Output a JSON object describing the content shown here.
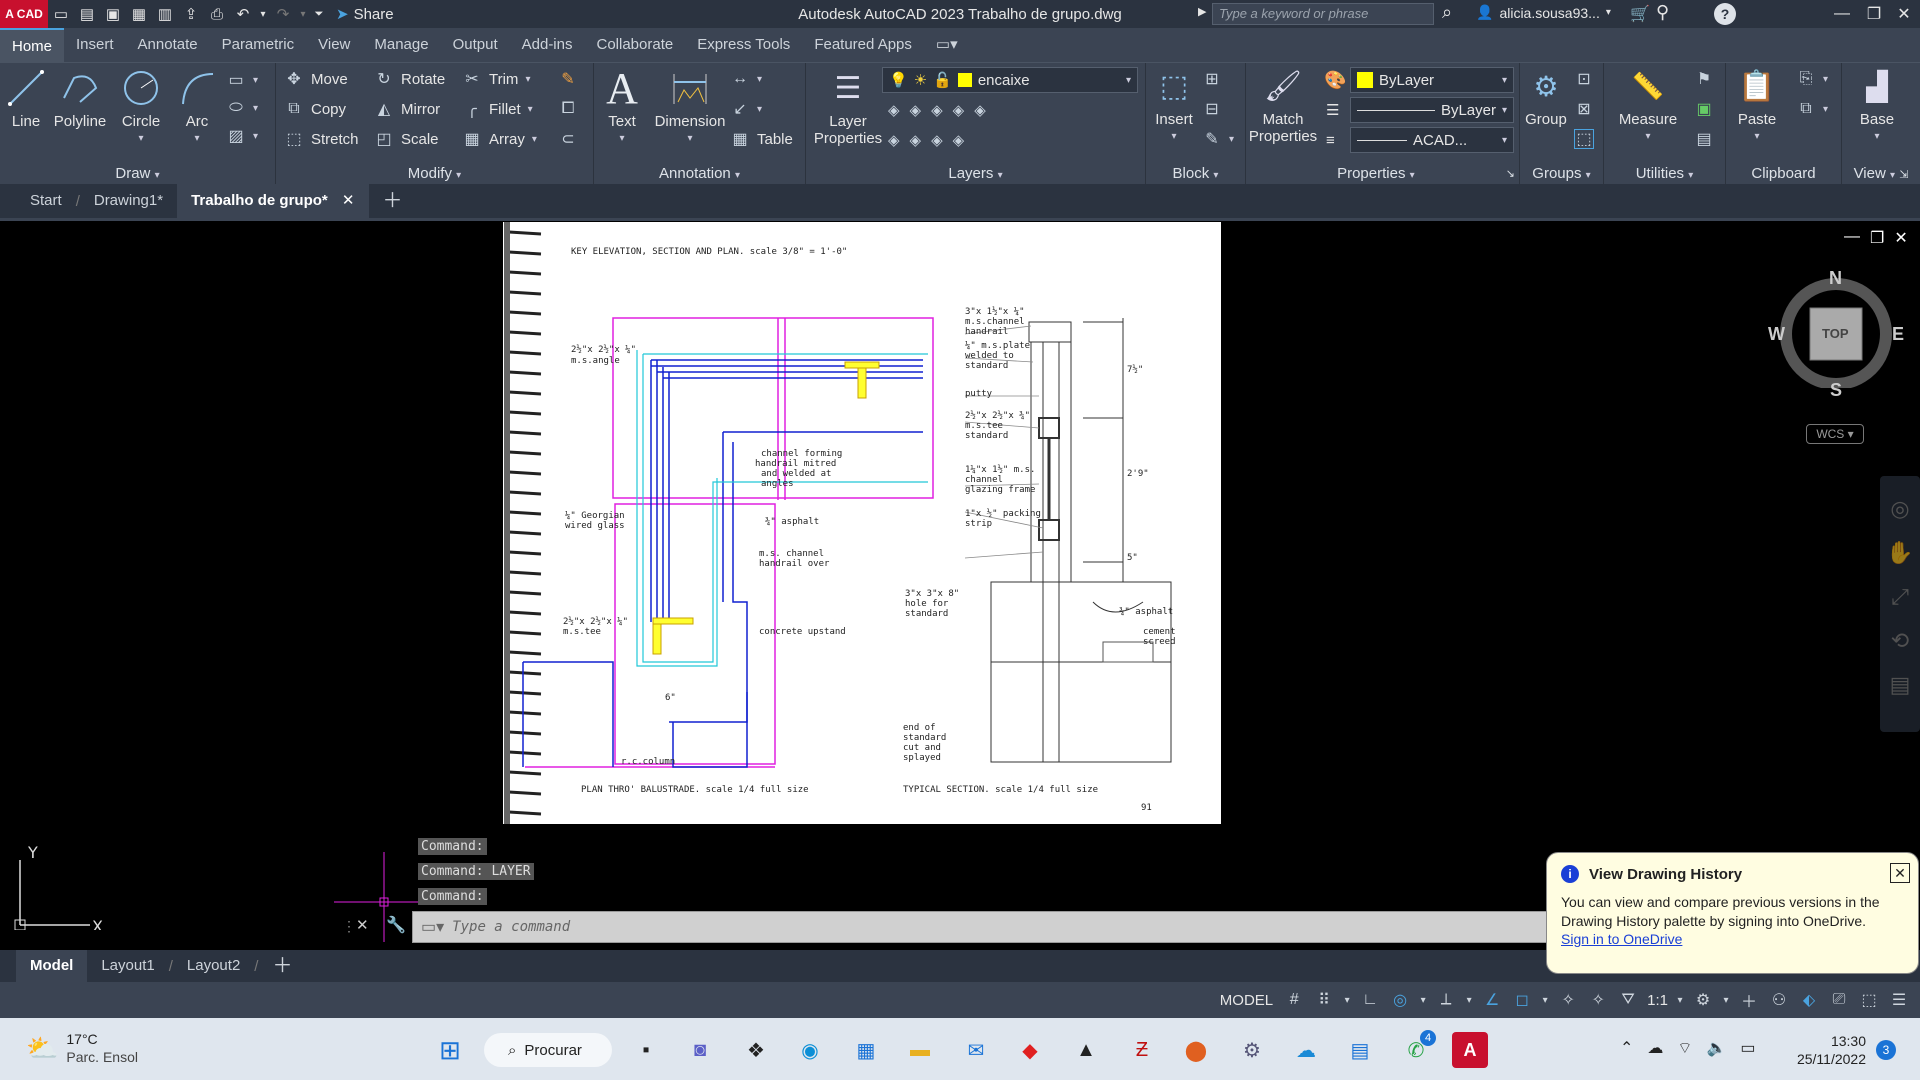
{
  "titlebar": {
    "logo": "A CAD",
    "share": "Share",
    "app_title": "Autodesk AutoCAD 2023    Trabalho de grupo.dwg",
    "search_placeholder": "Type a keyword or phrase",
    "user": "alicia.sousa93..."
  },
  "ribbon_tabs": [
    "Home",
    "Insert",
    "Annotate",
    "Parametric",
    "View",
    "Manage",
    "Output",
    "Add-ins",
    "Collaborate",
    "Express Tools",
    "Featured Apps"
  ],
  "ribbon": {
    "draw": {
      "title": "Draw",
      "line": "Line",
      "polyline": "Polyline",
      "circle": "Circle",
      "arc": "Arc"
    },
    "modify": {
      "title": "Modify",
      "move": "Move",
      "rotate": "Rotate",
      "trim": "Trim",
      "copy": "Copy",
      "mirror": "Mirror",
      "fillet": "Fillet",
      "stretch": "Stretch",
      "scale": "Scale",
      "array": "Array"
    },
    "annotation": {
      "title": "Annotation",
      "text": "Text",
      "dimension": "Dimension",
      "table": "Table"
    },
    "layers": {
      "title": "Layers",
      "layer_properties": "Layer Properties",
      "current_layer": "encaixe"
    },
    "block": {
      "title": "Block",
      "insert": "Insert"
    },
    "properties": {
      "title": "Properties",
      "match": "Match Properties",
      "color": "ByLayer",
      "linetype": "ByLayer",
      "lineweight": "ACAD..."
    },
    "groups": {
      "title": "Groups",
      "group": "Group"
    },
    "utilities": {
      "title": "Utilities",
      "measure": "Measure"
    },
    "clipboard": {
      "title": "Clipboard",
      "paste": "Paste"
    },
    "view": {
      "title": "View",
      "base": "Base"
    }
  },
  "file_tabs": [
    "Start",
    "Drawing1*",
    "Trabalho de grupo*"
  ],
  "drawing": {
    "header": "KEY  ELEVATION, SECTION  AND  PLAN.  scale 3/8\" = 1'-0\"",
    "caption_left": "PLAN  THRO'  BALUSTRADE.   scale  1/4  full  size",
    "caption_right": "TYPICAL   SECTION.    scale   1/4  full  size",
    "page_number": "91",
    "labels": {
      "l1": "2½\"x 2½\"x ¼\"",
      "l2": "m.s.angle",
      "l3": "channel forming",
      "l4": "handrail mitred",
      "l5": "and welded at",
      "l6": "angles",
      "l7": "¼\" Georgian",
      "l8": "wired glass",
      "l9": "¾\" asphalt",
      "l10": "m.s. channel",
      "l11": "handrail over",
      "l12": "2½\"x 2½\"x ¼\"",
      "l13": "m.s.tee",
      "l14": "concrete upstand",
      "l15": "6\"",
      "l16": "r.c.column",
      "r1": "3\"x 1½\"x ¼\"",
      "r2": "m.s.channel",
      "r3": "handrail",
      "r4": "¼\" m.s.plate",
      "r5": "welded to",
      "r6": "standard",
      "r7": "putty",
      "r8": "2½\"x 2½\"x ¾\"",
      "r9": "m.s.tee",
      "r10": "standard",
      "r11": "1¼\"x 1½\" m.s.",
      "r12": "channel",
      "r13": "glazing frame",
      "r14": "1\"x ½\" packing",
      "r15": "strip",
      "r16": "3\"x 3\"x 8\"",
      "r17": "hole for",
      "r18": "standard",
      "r19": "¾\" asphalt",
      "r20": "cement",
      "r21": "screed",
      "r22": "end of",
      "r23": "standard",
      "r24": "cut and",
      "r25": "splayed",
      "d1": "7½\"",
      "d2": "2'9\"",
      "d3": "5\""
    }
  },
  "viewcube": {
    "n": "N",
    "s": "S",
    "e": "E",
    "w": "W",
    "face": "TOP",
    "wcs": "WCS"
  },
  "command_history": [
    "Command:",
    "Command: LAYER",
    "Command:"
  ],
  "command_placeholder": "Type a command",
  "layout_tabs": [
    "Model",
    "Layout1",
    "Layout2"
  ],
  "statusbar": {
    "model": "MODEL",
    "scale": "1:1"
  },
  "notification": {
    "title": "View Drawing History",
    "body": "You can view and compare previous versions in the Drawing History palette by signing into OneDrive.",
    "link": "Sign in to OneDrive"
  },
  "taskbar": {
    "temp": "17°C",
    "weather": "Parc. Ensol",
    "search": "Procurar",
    "time": "13:30",
    "date": "25/11/2022",
    "mail_badge": "4",
    "notif_count": "3"
  },
  "colors": {
    "accent": "#4aa3df",
    "ribbon": "#3b4453",
    "titlebar": "#2b3340",
    "layer_swatch": "#ffff00",
    "notification_bg": "#fffde1"
  }
}
